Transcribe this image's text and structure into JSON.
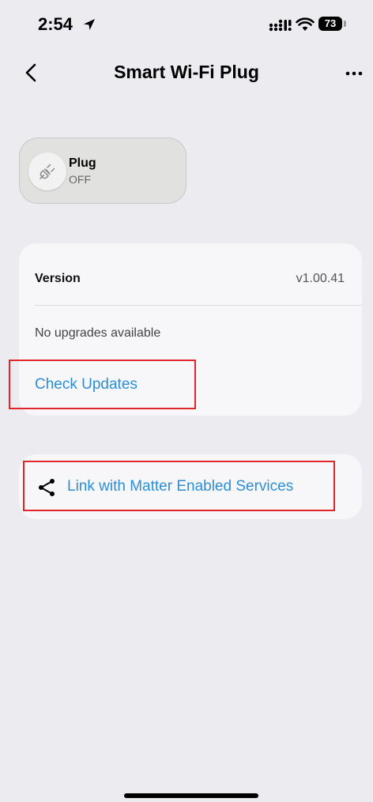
{
  "status_bar": {
    "time": "2:54",
    "battery_level": "73"
  },
  "header": {
    "title": "Smart Wi-Fi Plug"
  },
  "device": {
    "name": "Plug",
    "state": "OFF"
  },
  "firmware": {
    "version_label": "Version",
    "version_value": "v1.00.41",
    "upgrade_status": "No upgrades available",
    "check_updates_label": "Check Updates"
  },
  "matter": {
    "link_label": "Link with Matter Enabled Services"
  },
  "colors": {
    "accent": "#2b8ed8",
    "highlight": "#e0262a",
    "background": "#ebebf0",
    "card": "#f7f7f9"
  },
  "icons": {
    "back": "chevron-left-icon",
    "more": "ellipsis-icon",
    "device": "plug-icon",
    "share": "share-icon",
    "location": "location-arrow-icon",
    "signal": "cellular-signal-icon",
    "wifi": "wifi-icon"
  }
}
